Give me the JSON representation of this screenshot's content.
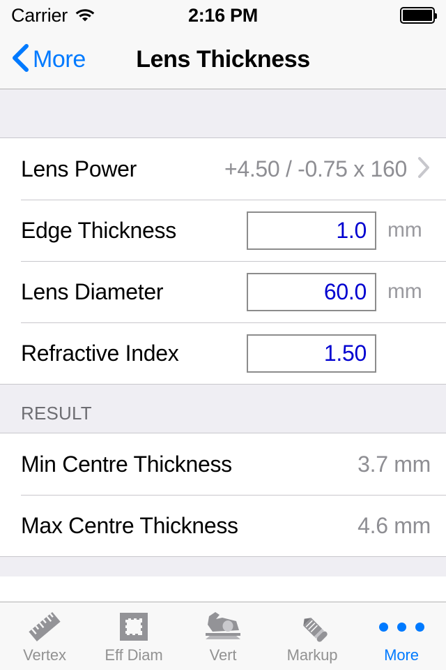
{
  "status_bar": {
    "carrier": "Carrier",
    "wifi_icon": "wifi-icon",
    "time": "2:16 PM",
    "battery_icon": "battery-full-icon"
  },
  "nav_bar": {
    "back_icon": "chevron-left-icon",
    "back_label": "More",
    "title": "Lens Thickness"
  },
  "input_section": {
    "rows": [
      {
        "label": "Lens Power",
        "value": "+4.50 / -0.75 x 160",
        "accessory": "chevron-right-icon"
      },
      {
        "label": "Edge Thickness",
        "value": "1.0",
        "unit": "mm"
      },
      {
        "label": "Lens Diameter",
        "value": "60.0",
        "unit": "mm"
      },
      {
        "label": "Refractive Index",
        "value": "1.50",
        "unit": ""
      }
    ]
  },
  "result_section": {
    "header": "RESULT",
    "rows": [
      {
        "label": "Min Centre Thickness",
        "value": "3.7 mm"
      },
      {
        "label": "Max Centre Thickness",
        "value": "4.6 mm"
      }
    ]
  },
  "tab_bar": {
    "items": [
      {
        "label": "Vertex",
        "icon": "ruler-icon",
        "active": false
      },
      {
        "label": "Eff Diam",
        "icon": "crop-frame-icon",
        "active": false
      },
      {
        "label": "Vert",
        "icon": "lensmeter-icon",
        "active": false
      },
      {
        "label": "Markup",
        "icon": "pencil-icon",
        "active": false
      },
      {
        "label": "More",
        "icon": "ellipsis-icon",
        "active": true
      }
    ]
  },
  "colors": {
    "accent": "#007aff",
    "input_text": "#0000d0",
    "muted": "#8e8e93",
    "group_bg": "#efeef3"
  }
}
